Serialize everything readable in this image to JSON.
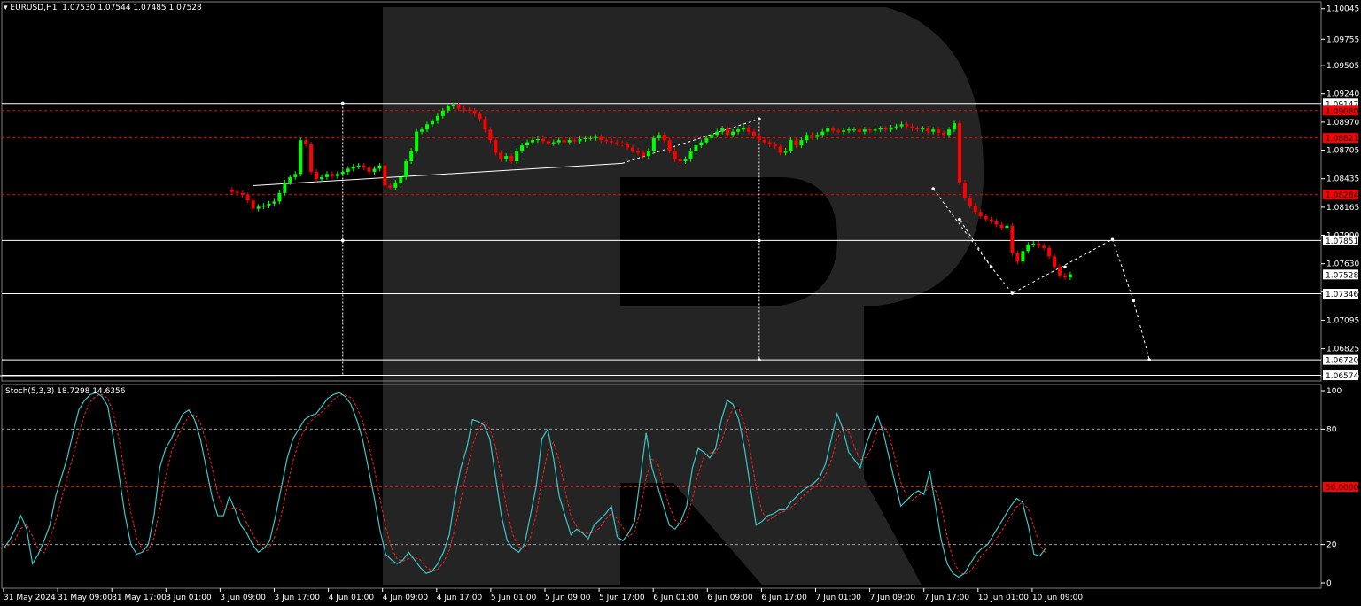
{
  "main_panel": {
    "symbol_header": "EURUSD,H1",
    "ohlc": [
      "1.07530",
      "1.07544",
      "1.07485",
      "1.07528"
    ]
  },
  "oscillator_panel": {
    "header": "Stoch(5,3,3) 18.7298 14.6356"
  },
  "colors": {
    "background": "#000000",
    "bull": "#00ff00",
    "bear": "#ff0000",
    "stoch_main": "#3cc8c8",
    "stoch_signal": "#ff2020",
    "level_line": "#ffffff",
    "red_level": "#ff0000",
    "axis_text": "#ffffff",
    "watermark": "#2a2a2a"
  },
  "chart_data": [
    {
      "type": "candlestick",
      "symbol": "EURUSD",
      "timeframe": "H1",
      "price_axis_ticks": [
        "1.10045",
        "1.09755",
        "1.09505",
        "1.09240",
        "1.08970",
        "1.08705",
        "1.08435",
        "1.08165",
        "1.07900",
        "1.07630",
        "1.07365",
        "1.07095",
        "1.06825",
        "1.06560"
      ],
      "ylim": [
        1.0652,
        1.1011
      ],
      "time_axis_labels": [
        "31 May 2024",
        "31 May 09:00",
        "31 May 17:00",
        "3 Jun 01:00",
        "3 Jun 09:00",
        "3 Jun 17:00",
        "4 Jun 01:00",
        "4 Jun 09:00",
        "4 Jun 17:00",
        "5 Jun 01:00",
        "5 Jun 09:00",
        "5 Jun 17:00",
        "6 Jun 01:00",
        "6 Jun 09:00",
        "6 Jun 17:00",
        "7 Jun 01:00",
        "7 Jun 09:00",
        "7 Jun 17:00",
        "10 Jun 01:00",
        "10 Jun 09:00"
      ],
      "close_path": [
        1.0831,
        1.083,
        1.0828,
        1.0823,
        1.0815,
        1.0817,
        1.0818,
        1.082,
        1.0822,
        1.083,
        1.084,
        1.0845,
        1.0848,
        1.088,
        1.0876,
        1.085,
        1.0843,
        1.0845,
        1.0848,
        1.0846,
        1.0848,
        1.085,
        1.0853,
        1.0855,
        1.0856,
        1.0854,
        1.085,
        1.0853,
        1.0856,
        1.0837,
        1.0835,
        1.084,
        1.0845,
        1.086,
        1.087,
        1.0888,
        1.089,
        1.0895,
        1.0898,
        1.0903,
        1.0908,
        1.0912,
        1.0913,
        1.091,
        1.0909,
        1.0908,
        1.0905,
        1.09,
        1.089,
        1.088,
        1.0868,
        1.0862,
        1.0865,
        1.086,
        1.087,
        1.0875,
        1.0878,
        1.088,
        1.0881,
        1.0879,
        1.0877,
        1.0878,
        1.088,
        1.0878,
        1.088,
        1.0879,
        1.0881,
        1.0882,
        1.0882,
        1.0883,
        1.088,
        1.0879,
        1.0878,
        1.0877,
        1.0876,
        1.0873,
        1.087,
        1.0868,
        1.0865,
        1.087,
        1.0882,
        1.0885,
        1.088,
        1.087,
        1.0862,
        1.086,
        1.0862,
        1.087,
        1.0875,
        1.0878,
        1.0882,
        1.0885,
        1.0888,
        1.0891,
        1.0885,
        1.0888,
        1.089,
        1.0892,
        1.0888,
        1.0884,
        1.088,
        1.0878,
        1.0876,
        1.0874,
        1.0868,
        1.087,
        1.088,
        1.0875,
        1.088,
        1.0885,
        1.0883,
        1.0885,
        1.0888,
        1.0891,
        1.0889,
        1.0888,
        1.0889,
        1.089,
        1.089,
        1.0888,
        1.089,
        1.0889,
        1.089,
        1.0891,
        1.089,
        1.0892,
        1.0893,
        1.0895,
        1.0893,
        1.0891,
        1.089,
        1.0891,
        1.0888,
        1.089,
        1.0887,
        1.0885,
        1.089,
        1.0896,
        1.084,
        1.0825,
        1.0818,
        1.0812,
        1.0808,
        1.0805,
        1.0803,
        1.08,
        1.0797,
        1.0799,
        1.0773,
        1.0765,
        1.0775,
        1.0781,
        1.0782,
        1.078,
        1.0778,
        1.077,
        1.076,
        1.0752,
        1.075,
        1.0753
      ],
      "levels": [
        {
          "label": "1.09147",
          "price": 1.09147,
          "style": "solid-white"
        },
        {
          "label": "1.09080",
          "price": 1.0908,
          "style": "dashed-red"
        },
        {
          "label": "1.08821",
          "price": 1.08821,
          "style": "dashed-red"
        },
        {
          "label": "1.08284",
          "price": 1.08284,
          "style": "dashed-red"
        },
        {
          "label": "1.07851",
          "price": 1.07851,
          "style": "solid-white"
        },
        {
          "label": "1.07528",
          "price": 1.07528,
          "style": "current-price"
        },
        {
          "label": "1.07346",
          "price": 1.07346,
          "style": "solid-white"
        },
        {
          "label": "1.06720",
          "price": 1.0672,
          "style": "solid-white"
        },
        {
          "label": "1.06574",
          "price": 1.06574,
          "style": "solid-white"
        }
      ]
    },
    {
      "type": "line",
      "indicator": "Stoch(5,3,3)",
      "main_value": "18.7298",
      "signal_value": "14.6356",
      "ylim": [
        0,
        100
      ],
      "y_ticks": [
        "100",
        "80",
        "20",
        "0"
      ],
      "mid_level_label": "50.0000",
      "levels": [
        80,
        50,
        20
      ],
      "main_series": [
        18,
        22,
        28,
        35,
        28,
        10,
        15,
        22,
        30,
        45,
        55,
        65,
        78,
        90,
        95,
        98,
        99,
        97,
        92,
        75,
        55,
        35,
        20,
        15,
        16,
        20,
        35,
        60,
        70,
        75,
        82,
        88,
        90,
        85,
        75,
        60,
        45,
        35,
        35,
        45,
        38,
        30,
        26,
        20,
        16,
        18,
        22,
        35,
        50,
        65,
        75,
        80,
        85,
        87,
        88,
        92,
        96,
        98,
        99,
        97,
        93,
        85,
        75,
        60,
        45,
        28,
        15,
        12,
        10,
        12,
        16,
        12,
        8,
        5,
        6,
        10,
        16,
        25,
        45,
        60,
        70,
        85,
        84,
        82,
        75,
        55,
        35,
        22,
        18,
        16,
        20,
        35,
        50,
        75,
        80,
        65,
        45,
        35,
        25,
        28,
        26,
        23,
        30,
        33,
        36,
        40,
        24,
        22,
        26,
        32,
        55,
        78,
        60,
        50,
        40,
        30,
        28,
        32,
        40,
        60,
        70,
        68,
        65,
        70,
        85,
        95,
        93,
        85,
        70,
        50,
        30,
        32,
        35,
        36,
        38,
        38,
        42,
        45,
        48,
        50,
        52,
        55,
        62,
        75,
        88,
        80,
        68,
        64,
        60,
        72,
        80,
        87,
        78,
        65,
        52,
        40,
        43,
        46,
        48,
        46,
        58,
        40,
        22,
        10,
        5,
        3,
        5,
        10,
        15,
        18,
        20,
        25,
        30,
        35,
        40,
        44,
        42,
        30,
        15,
        14,
        18
      ]
    }
  ]
}
